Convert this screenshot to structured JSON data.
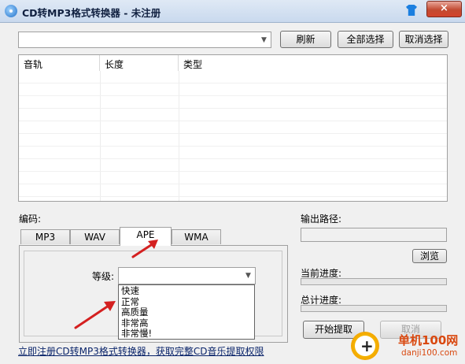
{
  "window": {
    "title": "CD转MP3格式转换器 - 未注册",
    "close_label": "×"
  },
  "toolbar": {
    "drive_select_value": "",
    "refresh_label": "刷新",
    "select_all_label": "全部选择",
    "deselect_label": "取消选择"
  },
  "tracks": {
    "columns": [
      "音轨",
      "长度",
      "类型"
    ],
    "rows": []
  },
  "encoding": {
    "label": "编码:",
    "tabs": [
      "MP3",
      "WAV",
      "APE",
      "WMA"
    ],
    "active_tab": "APE",
    "level_label": "等级:",
    "level_value": "",
    "level_options": [
      "快速",
      "正常",
      "高质量",
      "非常高",
      "非常慢!"
    ]
  },
  "output": {
    "path_label": "输出路径:",
    "path_value": "",
    "browse_label": "浏览",
    "current_progress_label": "当前进度:",
    "current_progress": 0,
    "total_progress_label": "总计进度:",
    "total_progress": 0,
    "start_label": "开始提取",
    "cancel_label": "取消"
  },
  "register_link": "立即注册CD转MP3格式转换器，获取完整CD音乐提取权限",
  "watermark": {
    "text": "单机100网",
    "sub": "danji100.com"
  },
  "colors": {
    "close_button": "#c24b32",
    "link": "#0a246a",
    "annotation_arrow": "#d42020",
    "watermark": "#d9480f"
  }
}
